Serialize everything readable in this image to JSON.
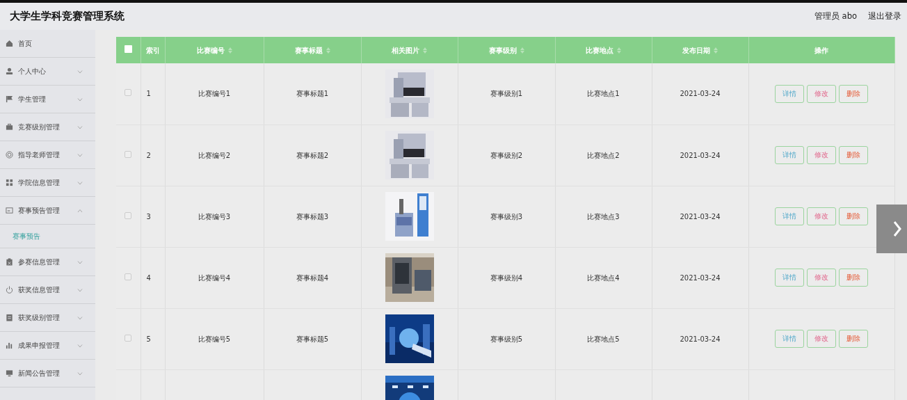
{
  "header": {
    "title": "大学生学科竞赛管理系统",
    "user": "管理员 abo",
    "logout": "退出登录"
  },
  "sidebar": {
    "items": [
      {
        "label": "首页",
        "kind": "link"
      },
      {
        "label": "个人中心",
        "kind": "menu",
        "expanded": false
      },
      {
        "label": "学生管理",
        "kind": "menu",
        "expanded": false
      },
      {
        "label": "竞赛级别管理",
        "kind": "menu",
        "expanded": false
      },
      {
        "label": "指导老师管理",
        "kind": "menu",
        "expanded": false
      },
      {
        "label": "学院信息管理",
        "kind": "menu",
        "expanded": false
      },
      {
        "label": "赛事预告管理",
        "kind": "menu",
        "expanded": true,
        "children": [
          {
            "label": "赛事预告",
            "selected": true
          }
        ]
      },
      {
        "label": "参赛信息管理",
        "kind": "menu",
        "expanded": false
      },
      {
        "label": "获奖信息管理",
        "kind": "menu",
        "expanded": false
      },
      {
        "label": "获奖级别管理",
        "kind": "menu",
        "expanded": false
      },
      {
        "label": "成果申报管理",
        "kind": "menu",
        "expanded": false
      },
      {
        "label": "新闻公告管理",
        "kind": "menu",
        "expanded": false
      }
    ]
  },
  "table": {
    "select_all": {
      "checked": false
    },
    "columns": [
      {
        "label": "索引",
        "sortable": false
      },
      {
        "label": "比赛编号",
        "sortable": true
      },
      {
        "label": "赛事标题",
        "sortable": true
      },
      {
        "label": "相关图片",
        "sortable": true
      },
      {
        "label": "赛事级别",
        "sortable": true
      },
      {
        "label": "比赛地点",
        "sortable": true
      },
      {
        "label": "发布日期",
        "sortable": true
      },
      {
        "label": "操作",
        "sortable": false
      }
    ],
    "rows": [
      {
        "checked": false,
        "cells": [
          "1",
          "比赛编号1",
          "赛事标题1",
          null,
          "赛事级别1",
          "比赛地点1",
          "2021-03-24"
        ],
        "image": {
          "kind": "picture"
        },
        "actions": [
          {
            "label": "详情",
            "kind": "detail"
          },
          {
            "label": "修改",
            "kind": "edit"
          },
          {
            "label": "删除",
            "kind": "delete"
          }
        ]
      },
      {
        "checked": false,
        "cells": [
          "2",
          "比赛编号2",
          "赛事标题2",
          null,
          "赛事级别2",
          "比赛地点2",
          "2021-03-24"
        ],
        "image": {
          "kind": "picture"
        },
        "actions": [
          {
            "label": "详情",
            "kind": "detail"
          },
          {
            "label": "修改",
            "kind": "edit"
          },
          {
            "label": "删除",
            "kind": "delete"
          }
        ]
      },
      {
        "checked": false,
        "cells": [
          "3",
          "比赛编号3",
          "赛事标题3",
          null,
          "赛事级别3",
          "比赛地点3",
          "2021-03-24"
        ],
        "image": {
          "kind": "picture"
        },
        "actions": [
          {
            "label": "详情",
            "kind": "detail"
          },
          {
            "label": "修改",
            "kind": "edit"
          },
          {
            "label": "删除",
            "kind": "delete"
          }
        ]
      },
      {
        "checked": false,
        "cells": [
          "4",
          "比赛编号4",
          "赛事标题4",
          null,
          "赛事级别4",
          "比赛地点4",
          "2021-03-24"
        ],
        "image": {
          "kind": "picture"
        },
        "actions": [
          {
            "label": "详情",
            "kind": "detail"
          },
          {
            "label": "修改",
            "kind": "edit"
          },
          {
            "label": "删除",
            "kind": "delete"
          }
        ]
      },
      {
        "checked": false,
        "cells": [
          "5",
          "比赛编号5",
          "赛事标题5",
          null,
          "赛事级别5",
          "比赛地点5",
          "2021-03-24"
        ],
        "image": {
          "kind": "picture"
        },
        "actions": [
          {
            "label": "详情",
            "kind": "detail"
          },
          {
            "label": "修改",
            "kind": "edit"
          },
          {
            "label": "删除",
            "kind": "delete"
          }
        ]
      },
      {
        "image": {
          "kind": "picture"
        }
      }
    ]
  }
}
